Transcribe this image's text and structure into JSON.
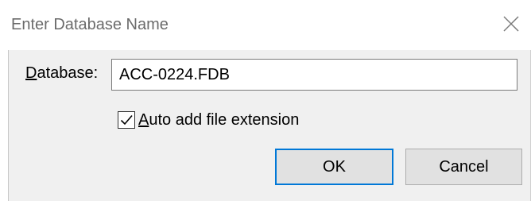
{
  "dialog": {
    "title": "Enter Database Name",
    "close_icon": "close-icon",
    "database_label_mnemonic": "D",
    "database_label_rest": "atabase:",
    "database_value": "ACC-0224.FDB",
    "checkbox_checked": true,
    "checkbox_label_mnemonic": "A",
    "checkbox_label_rest": "uto add file extension",
    "ok_label": "OK",
    "cancel_label": "Cancel",
    "accent_color": "#0078d7"
  }
}
